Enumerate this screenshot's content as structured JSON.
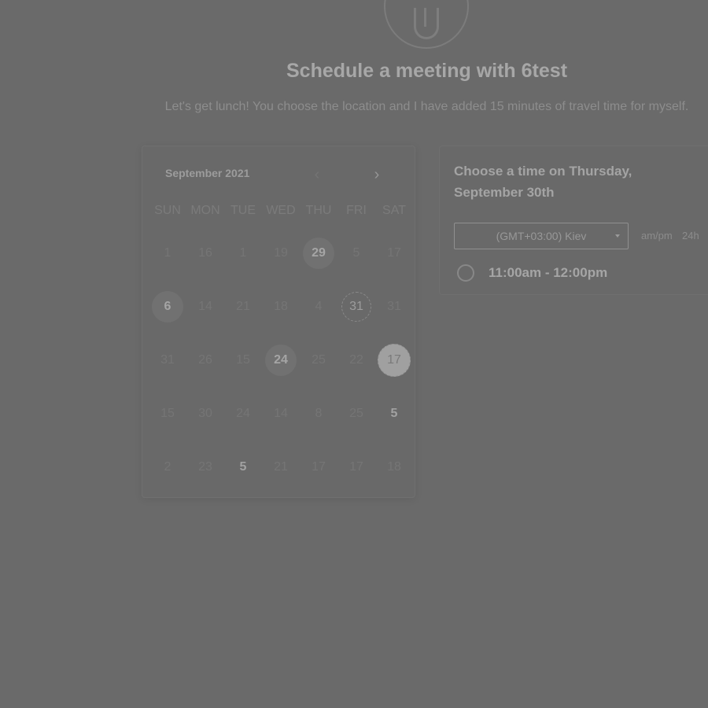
{
  "header": {
    "title": "Schedule a meeting with 6test",
    "description": "Let's get lunch! You choose the location and I have added 15 minutes of travel time for myself."
  },
  "calendar": {
    "month_label": "September 2021",
    "weekdays": [
      "SUN",
      "MON",
      "TUE",
      "WED",
      "THU",
      "FRI",
      "SAT"
    ],
    "weeks": [
      [
        {
          "d": "1"
        },
        {
          "d": "16"
        },
        {
          "d": "1"
        },
        {
          "d": "19"
        },
        {
          "d": "29",
          "state": "available"
        },
        {
          "d": "5"
        },
        {
          "d": "17"
        }
      ],
      [
        {
          "d": "6",
          "state": "available"
        },
        {
          "d": "14"
        },
        {
          "d": "21"
        },
        {
          "d": "18"
        },
        {
          "d": "4"
        },
        {
          "d": "31",
          "state": "today"
        },
        {
          "d": "31"
        }
      ],
      [
        {
          "d": "31"
        },
        {
          "d": "26"
        },
        {
          "d": "15"
        },
        {
          "d": "24",
          "state": "available"
        },
        {
          "d": "25"
        },
        {
          "d": "22"
        },
        {
          "d": "17",
          "state": "selected"
        }
      ],
      [
        {
          "d": "15"
        },
        {
          "d": "30"
        },
        {
          "d": "24"
        },
        {
          "d": "14"
        },
        {
          "d": "8"
        },
        {
          "d": "25"
        },
        {
          "d": "5",
          "state": "bold"
        }
      ],
      [
        {
          "d": "2"
        },
        {
          "d": "23"
        },
        {
          "d": "5",
          "state": "bold"
        },
        {
          "d": "21"
        },
        {
          "d": "17"
        },
        {
          "d": "17"
        },
        {
          "d": "18"
        }
      ]
    ]
  },
  "times": {
    "title": "Choose a time on Thursday, September 30th",
    "timezone": "(GMT+03:00) Kiev",
    "format_ampm": "am/pm",
    "format_24h": "24h",
    "slots": [
      {
        "label": "11:00am - 12:00pm"
      }
    ]
  },
  "icons": {
    "prev": "chevron-left-icon",
    "next": "chevron-right-icon",
    "dropdown": "caret-down-icon",
    "radio": "radio-icon"
  }
}
